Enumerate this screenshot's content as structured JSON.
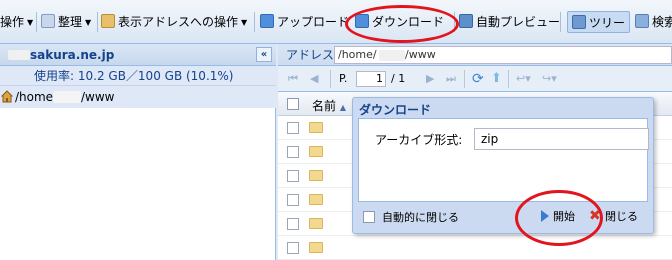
{
  "toolbar": {
    "ops_label": "操作",
    "organize_label": "整理",
    "display_ops_label": "表示アドレスへの操作",
    "upload_label": "アップロード",
    "download_label": "ダウンロード",
    "preview_label": "自動プレビュー",
    "tree_label": "ツリー",
    "search_label": "検索"
  },
  "left_panel": {
    "host": "sakura.ne.jp",
    "usage": "使用率: 10.2 GB／100 GB (10.1%)",
    "tree_path_prefix": "/home/",
    "tree_path_suffix": "/www",
    "collapse_glyph": "«"
  },
  "right_panel": {
    "address_label": "アドレス:",
    "address_prefix": "/home/",
    "address_suffix": "/www",
    "page_label": "P.",
    "page_value": "1",
    "page_total": "/ 1",
    "name_column": "名前"
  },
  "dialog": {
    "title": "ダウンロード",
    "archive_label": "アーカイブ形式:",
    "archive_value": "zip",
    "auto_close_label": "自動的に閉じる",
    "start_label": "開始",
    "close_label": "閉じる"
  },
  "colors": {
    "annotation": "#e2141c",
    "header_text": "#15428b",
    "accent": "#3b7bd0"
  }
}
